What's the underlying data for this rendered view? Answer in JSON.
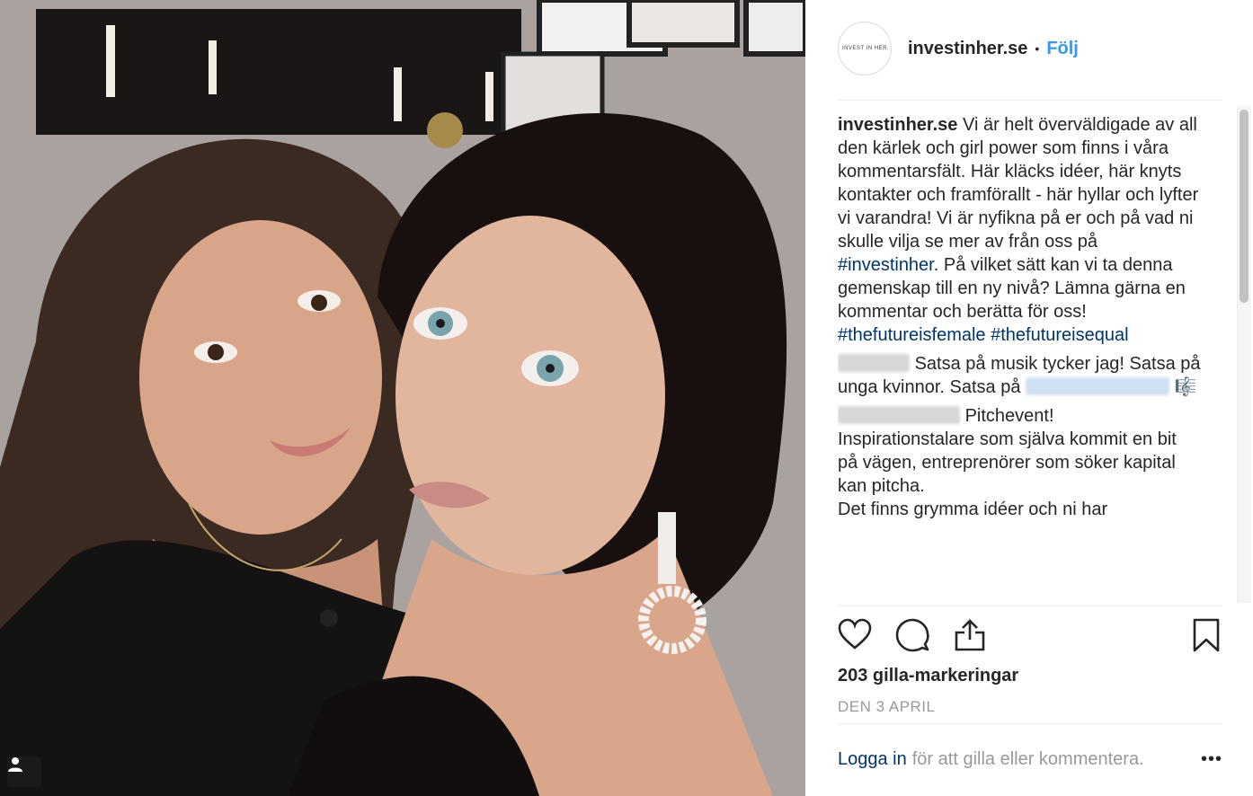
{
  "post": {
    "username": "investinher.se",
    "separator": "•",
    "follow_label": "Följ",
    "avatar_text": "INVEST IN HER"
  },
  "caption": {
    "username": "investinher.se",
    "text_1": "Vi är helt överväldigade av all den kärlek och girl power som finns i våra kommentarsfält. Här kläcks idéer, här knyts kontakter och framförallt - här hyllar och lyfter vi varandra! Vi är nyfikna på er och på vad ni skulle vilja se mer av från oss på",
    "hashtag_1": "#investinher",
    "text_2": ". På vilket sätt kan vi ta denna gemenskap till en ny nivå? Lämna gärna en kommentar och berätta för oss!",
    "hashtag_2": "#thefutureisfemale",
    "hashtag_3": "#thefutureisequal"
  },
  "comments": [
    {
      "text": "Satsa på musik tycker jag! Satsa på unga kvinnor. Satsa på",
      "emoji": "🎼"
    },
    {
      "text_1": "Pitchevent!",
      "text_2": "Inspirationstalare som själva kommit en bit på vägen, entreprenörer som söker kapital kan pitcha.",
      "text_3": "Det finns grymma idéer och ni har"
    }
  ],
  "actions": {
    "like_icon": "heart-icon",
    "comment_icon": "comment-icon",
    "share_icon": "share-icon",
    "save_icon": "bookmark-icon"
  },
  "likes_label": "203 gilla-markeringar",
  "date_label": "DEN 3 APRIL",
  "login": {
    "link": "Logga in",
    "rest": "för att gilla eller kommentera.",
    "more": "•••"
  }
}
